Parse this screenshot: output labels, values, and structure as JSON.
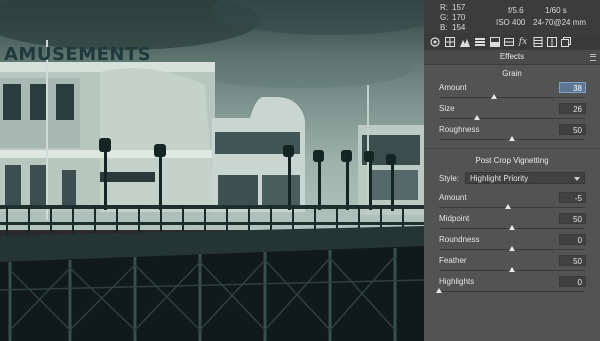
{
  "photo": {
    "sign_text": "AMUSEMENTS"
  },
  "info": {
    "r_label": "R:",
    "r_value": "157",
    "g_label": "G:",
    "g_value": "170",
    "b_label": "B:",
    "b_value": "154",
    "aperture": "f/5.6",
    "shutter": "1/60 s",
    "iso": "ISO 400",
    "lens": "24-70@24 mm"
  },
  "tabs": [
    {
      "name": "basic",
      "icon": "aperture-icon"
    },
    {
      "name": "tone-curve",
      "icon": "curve-grid-icon"
    },
    {
      "name": "detail",
      "icon": "mountains-icon"
    },
    {
      "name": "hsl",
      "icon": "hsl-bars-icon"
    },
    {
      "name": "split-toning",
      "icon": "split-toning-icon"
    },
    {
      "name": "lens-corrections",
      "icon": "lens-icon"
    },
    {
      "name": "effects",
      "icon": "fx-icon"
    },
    {
      "name": "camera-calibration",
      "icon": "calibration-icon"
    },
    {
      "name": "presets",
      "icon": "presets-icon"
    },
    {
      "name": "snapshots",
      "icon": "snapshots-icon"
    }
  ],
  "section_title": "Effects",
  "grain": {
    "title": "Grain",
    "amount": {
      "label": "Amount",
      "value": "38",
      "pos": 0.38
    },
    "size": {
      "label": "Size",
      "value": "26",
      "pos": 0.26
    },
    "roughness": {
      "label": "Roughness",
      "value": "50",
      "pos": 0.5
    }
  },
  "vignette": {
    "title": "Post Crop Vignetting",
    "style_label": "Style:",
    "style_value": "Highlight Priority",
    "amount": {
      "label": "Amount",
      "value": "-5",
      "pos": 0.475
    },
    "midpoint": {
      "label": "Midpoint",
      "value": "50",
      "pos": 0.5
    },
    "roundness": {
      "label": "Roundness",
      "value": "0",
      "pos": 0.5
    },
    "feather": {
      "label": "Feather",
      "value": "50",
      "pos": 0.5
    },
    "highlights": {
      "label": "Highlights",
      "value": "0",
      "pos": 0.0
    }
  },
  "colors": {
    "panel_bg": "#535353",
    "active_field": "#5d7694",
    "photo_tint": "#9fb3ad"
  }
}
